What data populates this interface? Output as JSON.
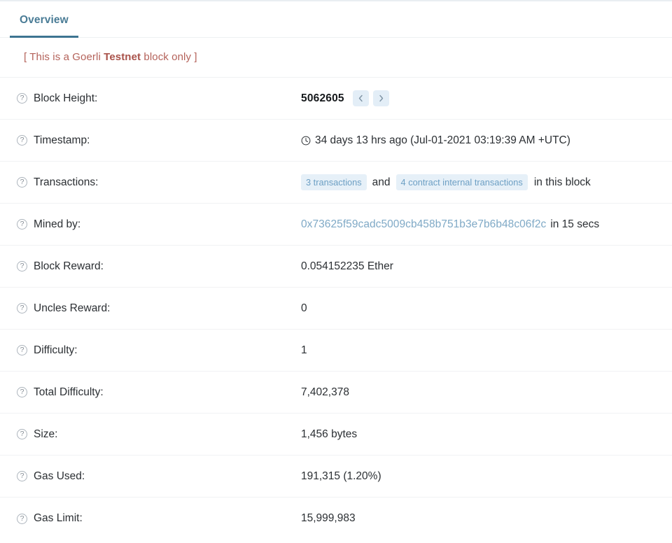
{
  "tabs": [
    {
      "label": "Overview",
      "active": true
    }
  ],
  "notice": {
    "prefix": "[ This is a Goerli ",
    "emphasis": "Testnet",
    "suffix": " block only ]"
  },
  "rows": [
    {
      "label": "Block Height:",
      "type": "block_height",
      "value": "5062605",
      "prev_label": "‹",
      "next_label": "›"
    },
    {
      "label": "Timestamp:",
      "type": "timestamp",
      "value": "34 days 13 hrs ago (Jul-01-2021 03:19:39 AM +UTC)"
    },
    {
      "label": "Transactions:",
      "type": "transactions",
      "badge_1": "3 transactions",
      "conjunction": "and",
      "badge_2": "4 contract internal transactions",
      "tail": "in this block"
    },
    {
      "label": "Mined by:",
      "type": "mined_by",
      "address": "0x73625f59cadc5009cb458b751b3e7b6b48c06f2c",
      "tail": "in 15 secs"
    },
    {
      "label": "Block Reward:",
      "type": "text",
      "value": "0.054152235 Ether"
    },
    {
      "label": "Uncles Reward:",
      "type": "text",
      "value": "0"
    },
    {
      "label": "Difficulty:",
      "type": "text",
      "value": "1"
    },
    {
      "label": "Total Difficulty:",
      "type": "text",
      "value": "7,402,378"
    },
    {
      "label": "Size:",
      "type": "text",
      "value": "1,456 bytes"
    },
    {
      "label": "Gas Used:",
      "type": "text",
      "value": "191,315 (1.20%)"
    },
    {
      "label": "Gas Limit:",
      "type": "text",
      "value": "15,999,983"
    }
  ],
  "icons": {
    "help": "?",
    "clock": "clock-icon",
    "chevron_left": "chevron-left-icon",
    "chevron_right": "chevron-right-icon"
  },
  "colors": {
    "tab_active": "#3d7491",
    "notice": "#b4625a",
    "link": "#7fa9c6",
    "badge_bg": "#e6f0f8",
    "nav_bg": "#e3eef7"
  }
}
